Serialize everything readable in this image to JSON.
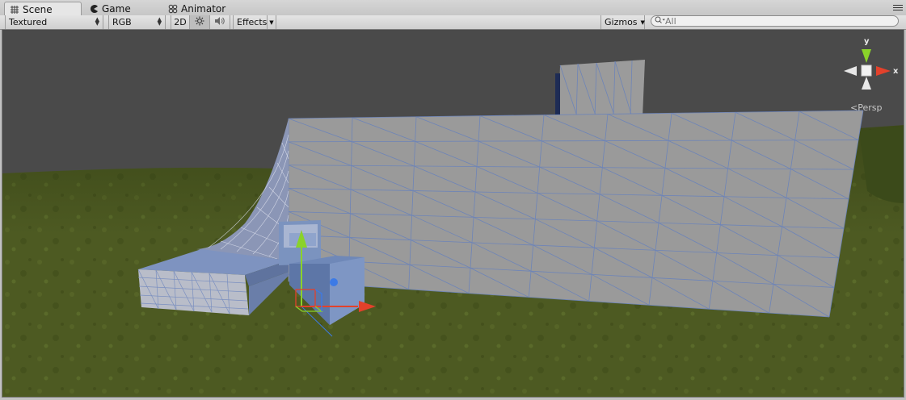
{
  "tabs": [
    {
      "label": "Scene",
      "icon": "grid-icon",
      "active": true
    },
    {
      "label": "Game",
      "icon": "pacman-icon",
      "active": false
    },
    {
      "label": "Animator",
      "icon": "animator-icon",
      "active": false
    }
  ],
  "toolbar": {
    "draw_mode": "Textured",
    "render_mode": "RGB",
    "mode_2d": "2D",
    "lighting_icon": "sun-icon",
    "audio_icon": "speaker-icon",
    "effects": "Effects",
    "gizmos": "Gizmos"
  },
  "search": {
    "placeholder": "All",
    "value": ""
  },
  "scene_gizmo": {
    "y_label": "y",
    "x_label": "x",
    "projection": "Persp"
  },
  "colors": {
    "skybox": "#4a4a4a",
    "ground": "#4d5a22",
    "mesh_face": "#9a9a9a",
    "mesh_wire": "#6d84b8",
    "selected_mesh": "#7b93bf",
    "axis_x": "#e3412b",
    "axis_y": "#8ad22a",
    "axis_z": "#3c7ae6"
  }
}
